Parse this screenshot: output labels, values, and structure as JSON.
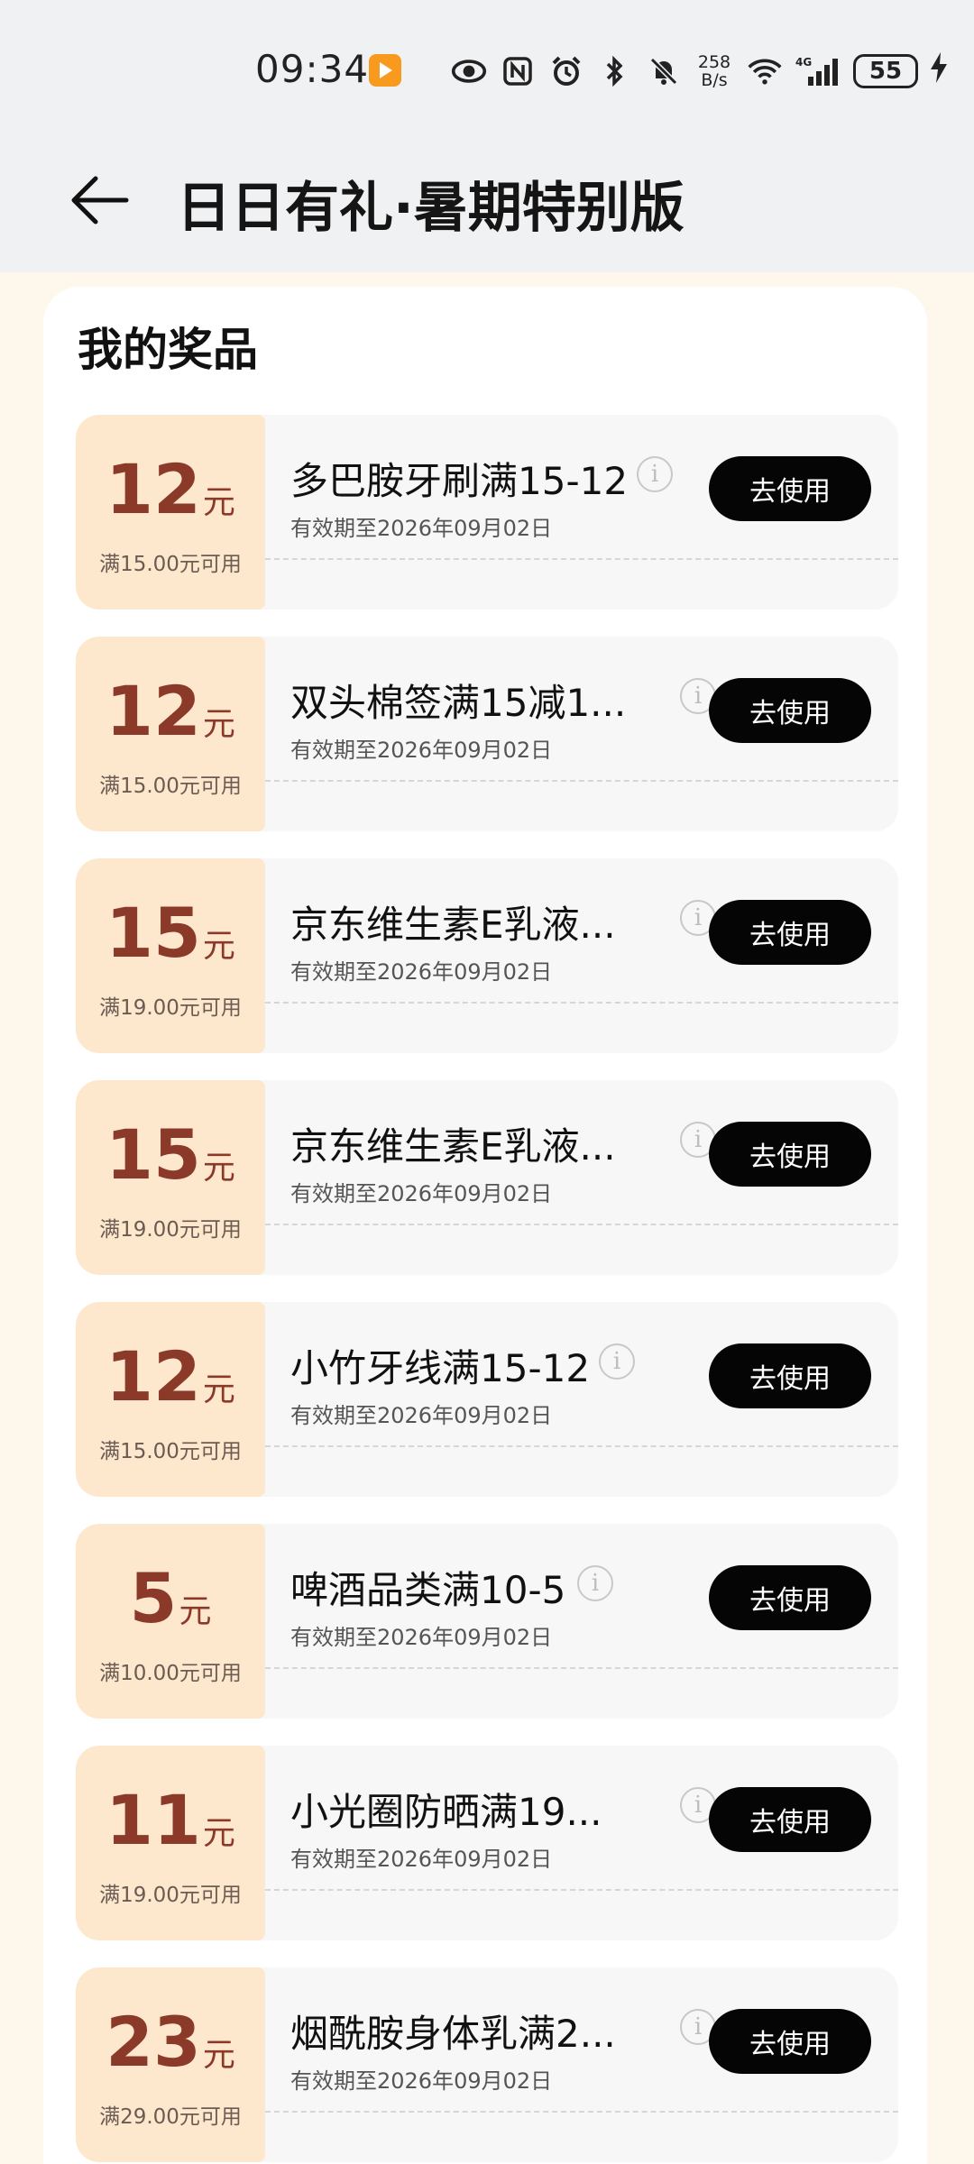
{
  "status_bar": {
    "time": "09:34",
    "net_speed_top": "258",
    "net_speed_bottom": "B/s",
    "signal_label": "4G",
    "battery": "55"
  },
  "header": {
    "title": "日日有礼·暑期特别版"
  },
  "section": {
    "title": "我的奖品"
  },
  "coupons": [
    {
      "amount": "12",
      "unit": "元",
      "min": "满15.00元可用",
      "name": "多巴胺牙刷满15-12",
      "expiry": "有效期至2026年09月02日",
      "button": "去使用"
    },
    {
      "amount": "12",
      "unit": "元",
      "min": "满15.00元可用",
      "name": "双头棉签满15减1...",
      "expiry": "有效期至2026年09月02日",
      "button": "去使用"
    },
    {
      "amount": "15",
      "unit": "元",
      "min": "满19.00元可用",
      "name": "京东维生素E乳液...",
      "expiry": "有效期至2026年09月02日",
      "button": "去使用"
    },
    {
      "amount": "15",
      "unit": "元",
      "min": "满19.00元可用",
      "name": "京东维生素E乳液...",
      "expiry": "有效期至2026年09月02日",
      "button": "去使用"
    },
    {
      "amount": "12",
      "unit": "元",
      "min": "满15.00元可用",
      "name": "小竹牙线满15-12",
      "expiry": "有效期至2026年09月02日",
      "button": "去使用"
    },
    {
      "amount": "5",
      "unit": "元",
      "min": "满10.00元可用",
      "name": "啤酒品类满10-5",
      "expiry": "有效期至2026年09月02日",
      "button": "去使用"
    },
    {
      "amount": "11",
      "unit": "元",
      "min": "满19.00元可用",
      "name": "小光圈防晒满19...",
      "expiry": "有效期至2026年09月02日",
      "button": "去使用"
    },
    {
      "amount": "23",
      "unit": "元",
      "min": "满29.00元可用",
      "name": "烟酰胺身体乳满2...",
      "expiry": "有效期至2026年09月02日",
      "button": "去使用"
    }
  ],
  "icons": {
    "back": "arrow-left-icon",
    "info": "info-icon"
  }
}
